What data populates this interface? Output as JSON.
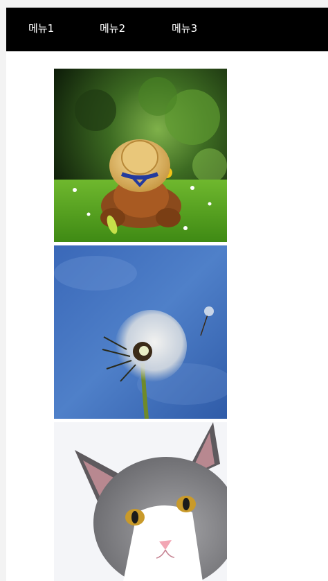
{
  "nav": {
    "items": [
      {
        "label": "메뉴1"
      },
      {
        "label": "메뉴2"
      },
      {
        "label": "메뉴3"
      }
    ]
  },
  "gallery": {
    "images": [
      {
        "icon": "teddy-bear-straw-hat-photo"
      },
      {
        "icon": "dandelion-sky-photo"
      },
      {
        "icon": "gray-white-cat-photo"
      }
    ]
  },
  "colors": {
    "nav_bg": "#000000",
    "nav_text": "#ffffff",
    "page_bg": "#ffffff",
    "outer_bg": "#f3f3f3"
  }
}
